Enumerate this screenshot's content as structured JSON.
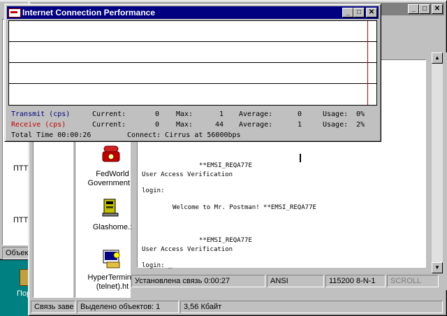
{
  "perf_window": {
    "title": "Internet Connection Performance",
    "transmit_label": "Transmit (cps)",
    "receive_label": "Receive (cps)",
    "transmit_row": {
      "current_label": "Current:",
      "current": "0",
      "max_label": "Max:",
      "max": "1",
      "avg_label": "Average:",
      "avg": "0",
      "usage_label": "Usage:",
      "usage": "0%"
    },
    "receive_row": {
      "current_label": "Current:",
      "current": "0",
      "max_label": "Max:",
      "max": "44",
      "avg_label": "Average:",
      "avg": "1",
      "usage_label": "Usage:",
      "usage": "2%"
    },
    "total_time": "Total Time 00:00:26",
    "connect": "Connect: Cirrus at 56000bps",
    "colors": {
      "transmit": "#000080",
      "receive": "#c00000"
    }
  },
  "terminal": {
    "lines": [
      "**EMSI_REQA77E",
      "User Access Verification",
      "login:",
      "Welcome to Mr. Postman! **EMSI_REQA77E",
      "**EMSI_REQA77E",
      "User Access Verification",
      "login: _"
    ],
    "status": {
      "connected": "Установлена связь 0:00:27",
      "emulation": "ANSI",
      "port": "115200 8-N-1",
      "scroll": "SCROLL"
    }
  },
  "folder": {
    "icons": [
      {
        "label1": "FedWorld",
        "label2": "Government B",
        "icon": "phone-icon"
      },
      {
        "label1": "Glashome.:",
        "label2": "",
        "icon": "modem-icon"
      },
      {
        "label1": "HyperTerminal",
        "label2": "(telnet).ht",
        "icon": "hyperterminal-icon"
      }
    ],
    "status_selected": "Выделено объектов: 1",
    "status_size": "3,56 Кбайт",
    "status_connection": "Связь заве"
  },
  "left_window": {
    "items": [
      "ПТТ",
      "ПТТ"
    ],
    "status": "Объек"
  },
  "desktop": {
    "label": "Пор"
  }
}
